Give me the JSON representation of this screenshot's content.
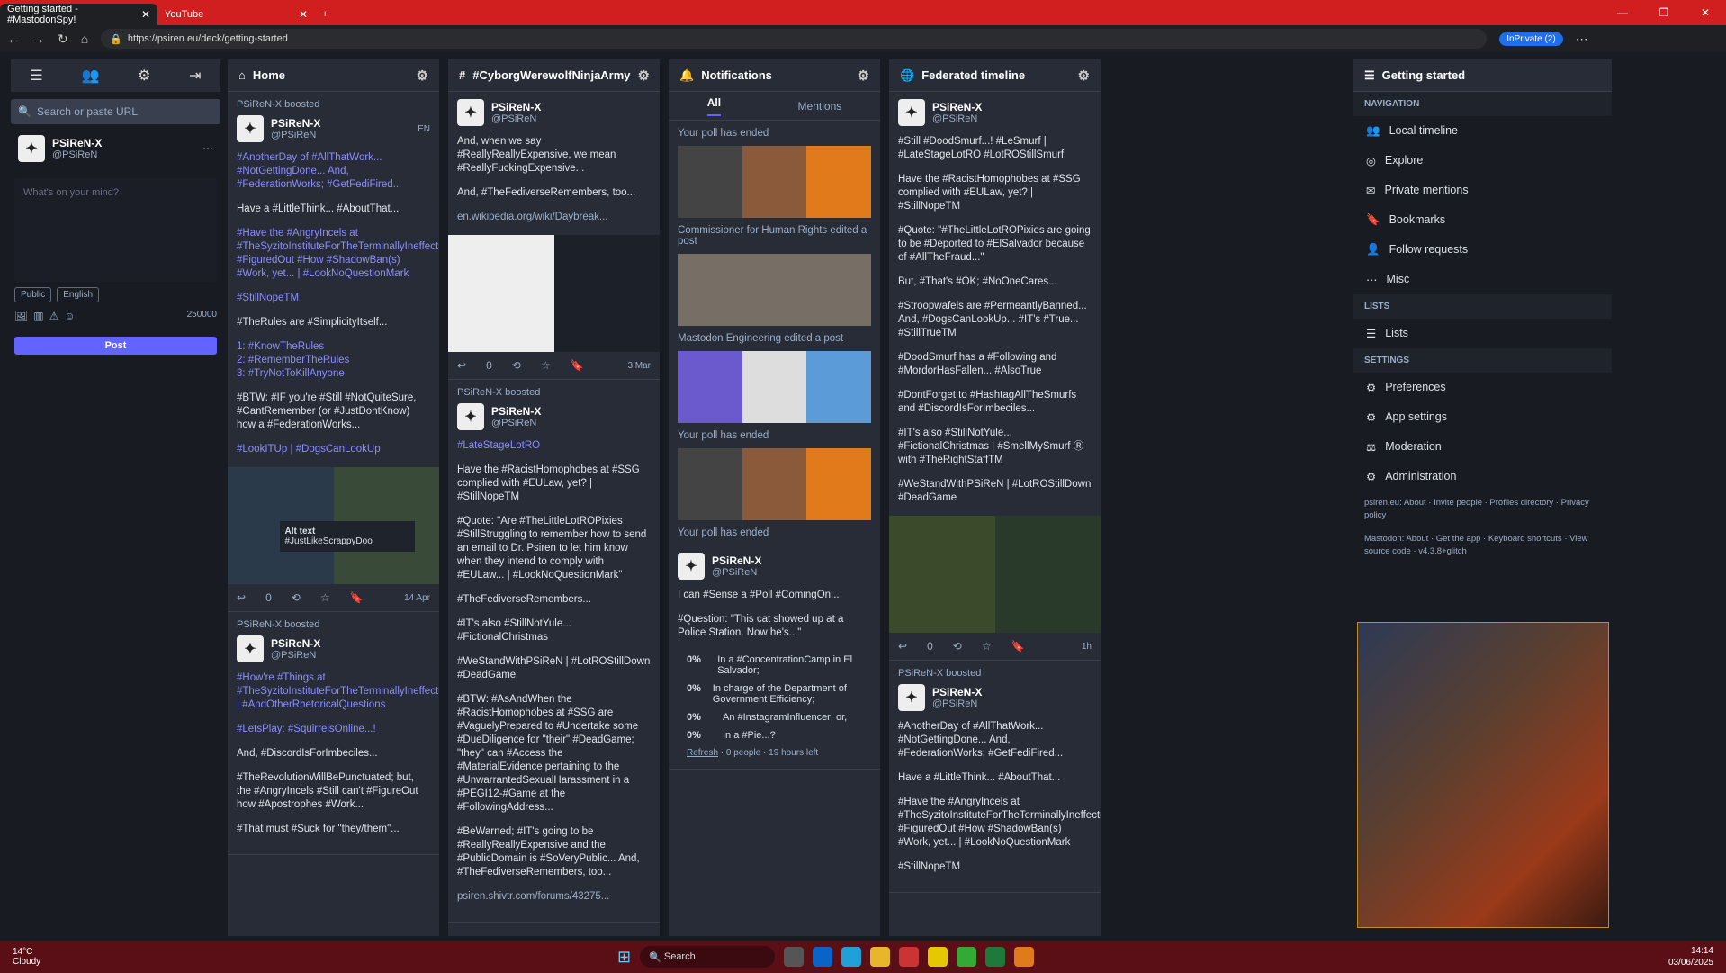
{
  "browser": {
    "tab1": "Getting started - #MastodonSpy!",
    "tab2": "YouTube",
    "url": "https://psiren.eu/deck/getting-started",
    "inprivate": "InPrivate (2)"
  },
  "sidebar": {
    "search_placeholder": "Search or paste URL",
    "name": "PSiReN-X",
    "handle": "@PSiReN",
    "compose_placeholder": "What's on your mind?",
    "visibility": "Public",
    "language": "English",
    "count": "250000",
    "post": "Post"
  },
  "home": {
    "title": "Home",
    "boost": "PSiReN-X boosted",
    "name": "PSiReN-X",
    "handle": "@PSiReN",
    "lang": "EN",
    "paras": [
      "#AnotherDay of #AllThatWork... #NotGettingDone... And, #FederationWorks; #GetFediFired...",
      "Have a #LittleThink... #AboutThat...",
      "#Have the #AngryIncels at #TheSyzitoInstituteForTheTerminallyIneffectual #FiguredOut #How #ShadowBan(s) #Work, yet... | #LookNoQuestionMark",
      "#StillNopeTM",
      "#TheRules are #SimplicityItself...",
      "1: #KnowTheRules\n2: #RememberTheRules\n3: #TryNotToKillAnyone",
      "#BTW: #IF you're #Still #NotQuiteSure, #CantRemember (or #JustDontKnow) how a #FederationWorks...",
      "#LookITUp | #DogsCanLookUp"
    ],
    "alt_title": "Alt text",
    "alt_body": "#JustLikeScrappyDoo",
    "replies": "0",
    "date": "14 Apr",
    "boost2": "PSiReN-X boosted",
    "paras2": [
      "#How're #Things at #TheSyzitoInstituteForTheTerminallyIneffectual... | #AndOtherRhetoricalQuestions",
      "#LetsPlay: #SquirrelsOnline...!",
      "And, #DiscordIsForImbeciles...",
      "#TheRevolutionWillBePunctuated; but, the #AngryIncels #Still can't #FigureOut how #Apostrophes #Work...",
      "#That must #Suck for \"they/them\"..."
    ]
  },
  "cyborg": {
    "title": "#CyborgWerewolfNinjaArmy",
    "name": "PSiReN-X",
    "handle": "@PSiReN",
    "paras": [
      "And, when we say #ReallyReallyExpensive, we mean #ReallyFuckingExpensive...",
      "And, #TheFediverseRemembers, too..."
    ],
    "link": "en.wikipedia.org/wiki/Daybreak...",
    "replies": "0",
    "date": "3 Mar",
    "boost": "PSiReN-X boosted",
    "paras2": [
      "#LateStageLotRO",
      "Have the #RacistHomophobes at #SSG complied with #EULaw, yet? | #StillNopeTM",
      "#Quote: \"Are #TheLittleLotROPixies #StillStruggling to remember how to send an email to Dr. Psiren to let him know when they intend to comply with #EULaw... | #LookNoQuestionMark\"",
      "#TheFediverseRemembers...",
      "#IT's also #StillNotYule... #FictionalChristmas",
      "#WeStandWithPSiReN | #LotROStillDown #DeadGame",
      "#BTW: #AsAndWhen the #RacistHomophobes at #SSG are #VaguelyPrepared to #Undertake some #DueDiligence for \"their\" #DeadGame; \"they\" can #Access the #MaterialEvidence pertaining to the #UnwarrantedSexualHarassment in a #PEGI12-#Game at the #FollowingAddress...",
      "#BeWarned; #IT's going to be #ReallyReallyExpensive and the #PublicDomain is #SoVeryPublic... And, #TheFediverseRemembers, too..."
    ],
    "link2": "psiren.shivtr.com/forums/43275..."
  },
  "notif": {
    "title": "Notifications",
    "all": "All",
    "mentions": "Mentions",
    "poll_ended": "Your poll has ended",
    "edit1": "Commissioner for Human Rights edited a post",
    "edit2": "Mastodon Engineering edited a post",
    "name": "PSiReN-X",
    "handle": "@PSiReN",
    "q1": "I can #Sense a #Poll #ComingOn...",
    "q2": "#Question: \"This cat showed up at a Police Station. Now he's...\"",
    "options": [
      {
        "pct": "0%",
        "text": "In a #ConcentrationCamp in El Salvador;"
      },
      {
        "pct": "0%",
        "text": "In charge of the Department of Government Efficiency;"
      },
      {
        "pct": "0%",
        "text": "An #InstagramInfluencer; or,"
      },
      {
        "pct": "0%",
        "text": "In a #Pie...?"
      }
    ],
    "refresh": "Refresh",
    "footer": "· 0 people · 19 hours left"
  },
  "fed": {
    "title": "Federated timeline",
    "name": "PSiReN-X",
    "handle": "@PSiReN",
    "paras": [
      "#Still #DoodSmurf...! #LeSmurf | #LateStageLotRO #LotROStillSmurf",
      "Have the #RacistHomophobes at #SSG complied with #EULaw, yet? | #StillNopeTM",
      "#Quote: \"#TheLittleLotROPixies are going to be #Deported to #ElSalvador because of #AllTheFraud...\"",
      "But, #That's #OK; #NoOneCares...",
      "#Stroopwafels are #PermeantlyBanned... And, #DogsCanLookUp... #IT's #True... #StillTrueTM",
      "#DoodSmurf has a #Following and #MordorHasFallen... #AlsoTrue",
      "#DontForget to #HashtagAllTheSmurfs and #DiscordIsForImbeciles...",
      "#IT's also #StillNotYule... #FictionalChristmas | #SmellMySmurf Ⓡ with #TheRightStaffTM",
      "#WeStandWithPSiReN | #LotROStillDown #DeadGame"
    ],
    "replies": "0",
    "date": "1h",
    "boost": "PSiReN-X boosted",
    "paras2": [
      "#AnotherDay of #AllThatWork... #NotGettingDone... And, #FederationWorks; #GetFediFired...",
      "Have a #LittleThink... #AboutThat...",
      "#Have the #AngryIncels at #TheSyzitoInstituteForTheTerminallyIneffectual #FiguredOut #How #ShadowBan(s) #Work, yet... | #LookNoQuestionMark",
      "#StillNopeTM"
    ]
  },
  "gs": {
    "title": "Getting started",
    "nav": "NAVIGATION",
    "nav_items": [
      "Local timeline",
      "Explore",
      "Private mentions",
      "Bookmarks",
      "Follow requests",
      "Misc"
    ],
    "lists": "LISTS",
    "lists_item": "Lists",
    "settings": "SETTINGS",
    "settings_items": [
      "Preferences",
      "App settings",
      "Moderation",
      "Administration"
    ],
    "foot1": "psiren.eu: About · Invite people · Profiles directory · Privacy policy",
    "foot2": "Mastodon: About · Get the app · Keyboard shortcuts · View source code · v4.3.8+glitch"
  },
  "taskbar": {
    "temp": "14°C",
    "weather": "Cloudy",
    "search": "Search",
    "time": "14:14",
    "date": "03/06/2025"
  }
}
